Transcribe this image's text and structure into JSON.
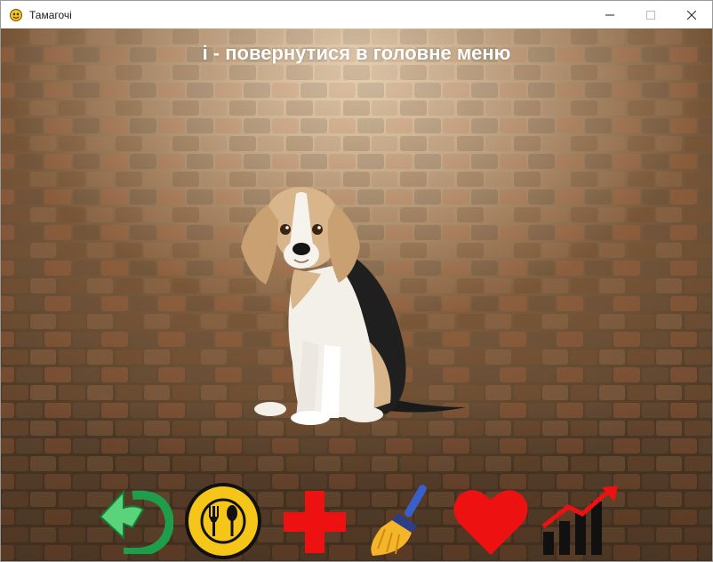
{
  "window": {
    "title": "Тамагочі",
    "app_icon": "pygame-snake-icon",
    "controls": [
      "minimize-icon",
      "maximize-icon",
      "close-icon"
    ]
  },
  "game": {
    "hint": "і - повернутися в головне меню",
    "pet": "beagle-dog",
    "background": "stone-brick-wall"
  },
  "toolbar": {
    "buttons": [
      {
        "name": "back-button",
        "icon": "undo-arrow-icon",
        "color": "#1e9e4a"
      },
      {
        "name": "feed-button",
        "icon": "fork-spoon-plate-icon",
        "color": "#f5c518"
      },
      {
        "name": "heal-button",
        "icon": "red-cross-icon",
        "color": "#ee1111"
      },
      {
        "name": "clean-button",
        "icon": "broom-icon",
        "color": "#3a5fc8"
      },
      {
        "name": "love-button",
        "icon": "heart-icon",
        "color": "#ee1111"
      },
      {
        "name": "stats-button",
        "icon": "growth-chart-icon",
        "color": "#111111"
      }
    ]
  }
}
